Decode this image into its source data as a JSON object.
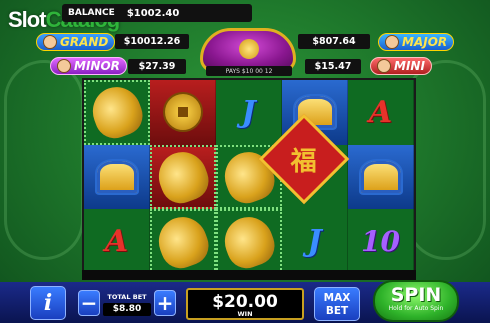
{
  "watermark": {
    "part1": "Slot",
    "part2": "Catalog"
  },
  "balance": {
    "label": "BALANCE",
    "value": "$1002.40"
  },
  "jackpots": {
    "grand": {
      "label": "GRAND",
      "value": "$10012.26"
    },
    "major": {
      "label": "MAJOR",
      "value": "$807.64"
    },
    "minor": {
      "label": "MINOR",
      "value": "$27.39"
    },
    "mini": {
      "label": "MINI",
      "value": "$15.47"
    }
  },
  "pot": {
    "pays_text": "PAYS  $10  00  12"
  },
  "reels": {
    "rows": [
      [
        "fish",
        "coin",
        "J",
        "gold",
        "A"
      ],
      [
        "gold",
        "fish",
        "fish",
        "fu",
        "gold"
      ],
      [
        "A",
        "fish",
        "fish",
        "J",
        "10"
      ]
    ],
    "letters": {
      "r0c2": "J",
      "r0c4": "A",
      "r2c0": "A",
      "r2c3": "J",
      "r2c4": "10"
    },
    "fu_char": "福"
  },
  "controls": {
    "info_label": "i",
    "minus_label": "−",
    "plus_label": "+",
    "total_bet_label": "TOTAL BET",
    "total_bet_value": "$8.80",
    "win_value": "$20.00",
    "win_label": "WIN",
    "maxbet_line1": "MAX",
    "maxbet_line2": "BET",
    "spin_label": "SPIN",
    "spin_sub": "Hold for Auto Spin"
  }
}
